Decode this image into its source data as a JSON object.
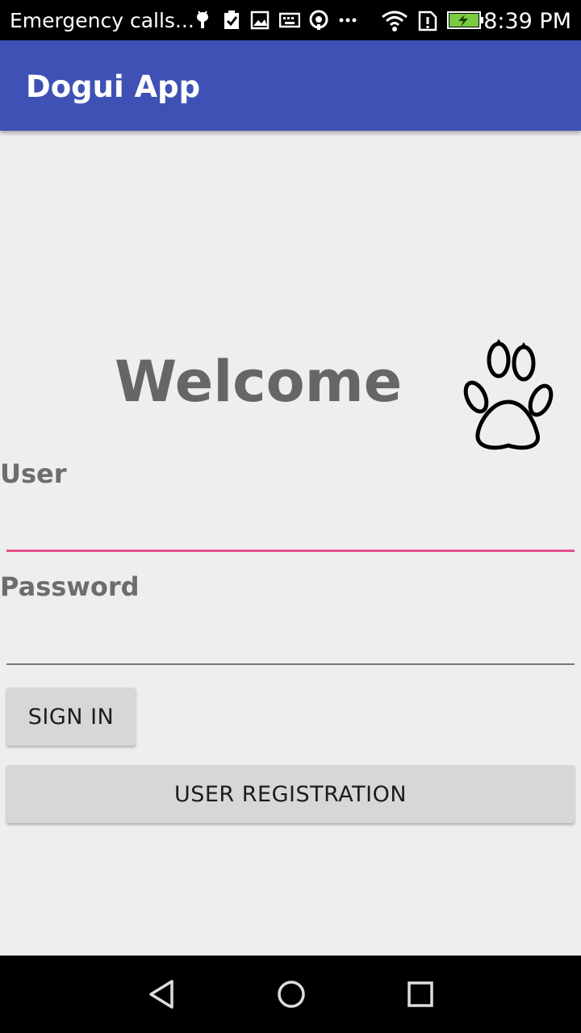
{
  "status_bar": {
    "carrier_text": "Emergency calls...",
    "time": "8:39 PM",
    "icons": [
      "android-icon",
      "clipboard-check-icon",
      "image-icon",
      "keyboard-icon",
      "hotspot-icon",
      "more-dots-icon",
      "wifi-icon",
      "sim-alert-icon",
      "battery-charging-icon"
    ]
  },
  "app_bar": {
    "title": "Dogui App",
    "color": "#3f51b5"
  },
  "main": {
    "welcome": "Welcome",
    "logo_icon": "paw-icon",
    "user_label": "User",
    "user_value": "",
    "password_label": "Password",
    "password_value": "",
    "accent_color": "#e4508a",
    "sign_in_label": "SIGN IN",
    "registration_label": "USER REGISTRATION"
  },
  "nav_bar": {
    "icons": [
      "back-icon",
      "home-icon",
      "recents-icon"
    ]
  }
}
